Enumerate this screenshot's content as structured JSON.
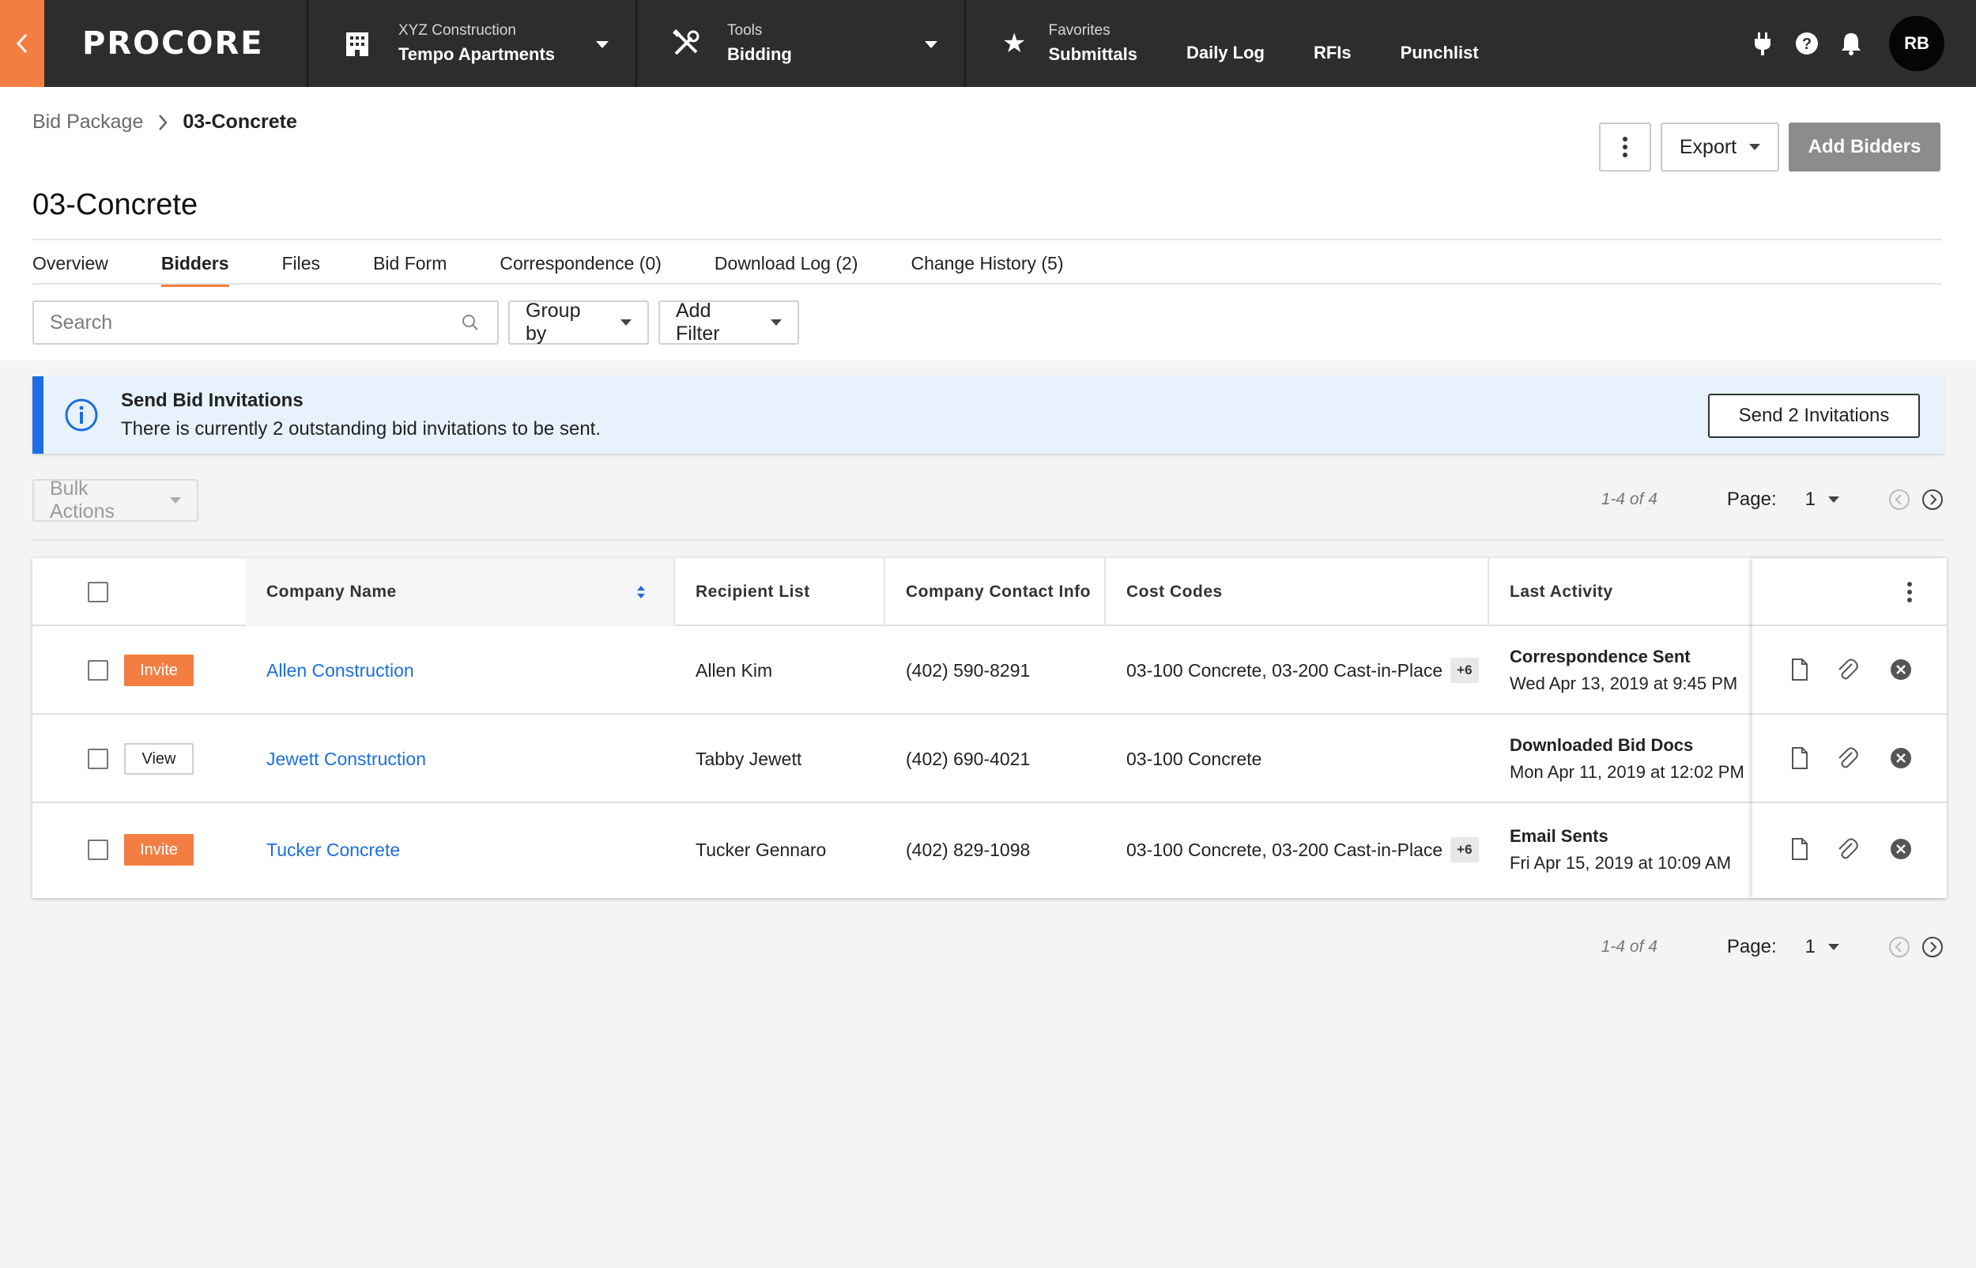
{
  "nav": {
    "logo": "PROCORE",
    "project": {
      "company": "XYZ Construction",
      "name": "Tempo Apartments"
    },
    "tool": {
      "label": "Tools",
      "name": "Bidding"
    },
    "favorites": {
      "label": "Favorites",
      "items": [
        "Submittals",
        "Daily Log",
        "RFIs",
        "Punchlist"
      ]
    },
    "avatar_initials": "RB"
  },
  "breadcrumb": {
    "parent": "Bid Package",
    "current": "03-Concrete"
  },
  "page_title": "03-Concrete",
  "header_actions": {
    "export": "Export",
    "add_bidders": "Add Bidders"
  },
  "tabs": [
    {
      "label": "Overview",
      "active": false
    },
    {
      "label": "Bidders",
      "active": true
    },
    {
      "label": "Files",
      "active": false
    },
    {
      "label": "Bid Form",
      "active": false
    },
    {
      "label": "Correspondence (0)",
      "active": false
    },
    {
      "label": "Download Log (2)",
      "active": false
    },
    {
      "label": "Change History (5)",
      "active": false
    }
  ],
  "filters": {
    "search_placeholder": "Search",
    "group_by": "Group by",
    "add_filter": "Add Filter"
  },
  "banner": {
    "title": "Send Bid Invitations",
    "body": "There is currently 2 outstanding bid invitations to be sent.",
    "button": "Send 2 Invitations"
  },
  "bulk_actions": "Bulk Actions",
  "pagination": {
    "count": "1-4 of 4",
    "page_label": "Page:",
    "page": "1"
  },
  "table": {
    "columns": [
      "Company Name",
      "Recipient List",
      "Company Contact Info",
      "Cost Codes",
      "Last Activity"
    ],
    "rows": [
      {
        "action": "Invite",
        "company": "Allen Construction",
        "recipient": "Allen Kim",
        "phone": "(402) 590-8291",
        "cost_codes": "03-100 Concrete, 03-200 Cast-in-Place",
        "cost_more": "+6",
        "activity_title": "Correspondence Sent",
        "activity_date": "Wed Apr 13, 2019 at 9:45 PM"
      },
      {
        "action": "View",
        "company": "Jewett Construction",
        "recipient": "Tabby Jewett",
        "phone": "(402) 690-4021",
        "cost_codes": "03-100 Concrete",
        "cost_more": "",
        "activity_title": "Downloaded Bid Docs",
        "activity_date": "Mon Apr 11, 2019 at 12:02 PM"
      },
      {
        "action": "Invite",
        "company": "Tucker Concrete",
        "recipient": "Tucker Gennaro",
        "phone": "(402) 829-1098",
        "cost_codes": "03-100 Concrete, 03-200 Cast-in-Place",
        "cost_more": "+6",
        "activity_title": "Email Sents",
        "activity_date": "Fri Apr 15, 2019 at 10:09 AM"
      }
    ]
  },
  "colors": {
    "brand_orange": "#f47e42",
    "nav_bg": "#2d2d2d",
    "link_blue": "#1c6fe0",
    "banner_bg": "#e8f2fc"
  },
  "icons": [
    "chevron-left-icon",
    "building-icon",
    "tools-icon",
    "star-icon",
    "plug-icon",
    "help-icon",
    "bell-icon",
    "search-icon",
    "info-icon",
    "sort-icon",
    "kebab-icon",
    "document-icon",
    "paperclip-icon",
    "remove-icon"
  ]
}
